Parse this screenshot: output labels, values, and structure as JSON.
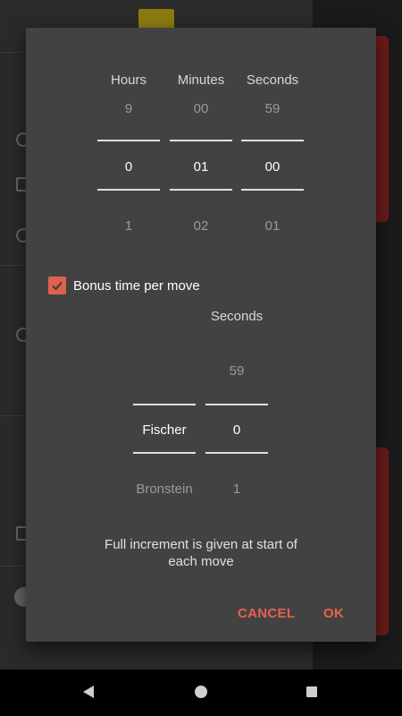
{
  "dialog": {
    "headers": {
      "hours": "Hours",
      "minutes": "Minutes",
      "seconds": "Seconds"
    },
    "time_picker": {
      "hours": {
        "prev": "9",
        "current": "0",
        "next": "1"
      },
      "minutes": {
        "prev": "00",
        "current": "01",
        "next": "02"
      },
      "seconds": {
        "prev": "59",
        "current": "00",
        "next": "01"
      }
    },
    "bonus": {
      "label": "Bonus time per move",
      "checked": true
    },
    "bonus_headers": {
      "seconds": "Seconds"
    },
    "bonus_picker": {
      "type": {
        "prev": "",
        "current": "Fischer",
        "next": "Bronstein"
      },
      "seconds": {
        "prev": "59",
        "current": "0",
        "next": "1"
      }
    },
    "note": "Full increment is given at start of each move",
    "buttons": {
      "cancel": "CANCEL",
      "ok": "OK"
    }
  },
  "colors": {
    "accent": "#e8614f",
    "dialog_bg": "#424242"
  },
  "navbar": {
    "icons": [
      "back-icon",
      "home-icon",
      "recents-icon"
    ]
  }
}
